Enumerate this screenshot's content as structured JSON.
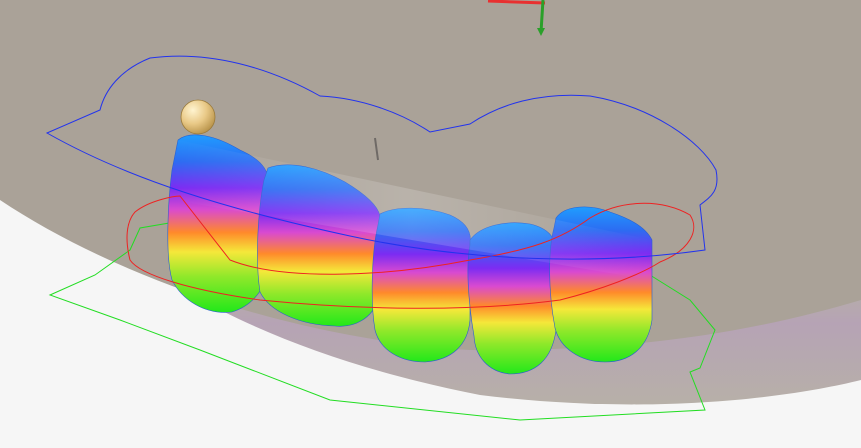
{
  "viewport": {
    "background_color": "#f6f6f6",
    "base_plane_color": "#aaa298",
    "base_rim_colors": [
      "#b7b0a8",
      "#c8bfa9",
      "#b3c38f",
      "#b6a3b5",
      "#b7b0a8"
    ]
  },
  "model": {
    "teeth_count": 5,
    "height_map_gradient": [
      "#1f9dff",
      "#2c6cf2",
      "#7c2cf2",
      "#d94ad0",
      "#ff8a2a",
      "#f5e83a",
      "#8fe82a",
      "#22e81a"
    ],
    "contour_colors": {
      "upper": "#2233ee",
      "middle": "#ee2222",
      "lower": "#22dd22"
    }
  },
  "gizmo": {
    "x_axis_color": "#e83030",
    "y_axis_color": "#2aa02a"
  },
  "control_point": {
    "color": "#e9c987"
  }
}
